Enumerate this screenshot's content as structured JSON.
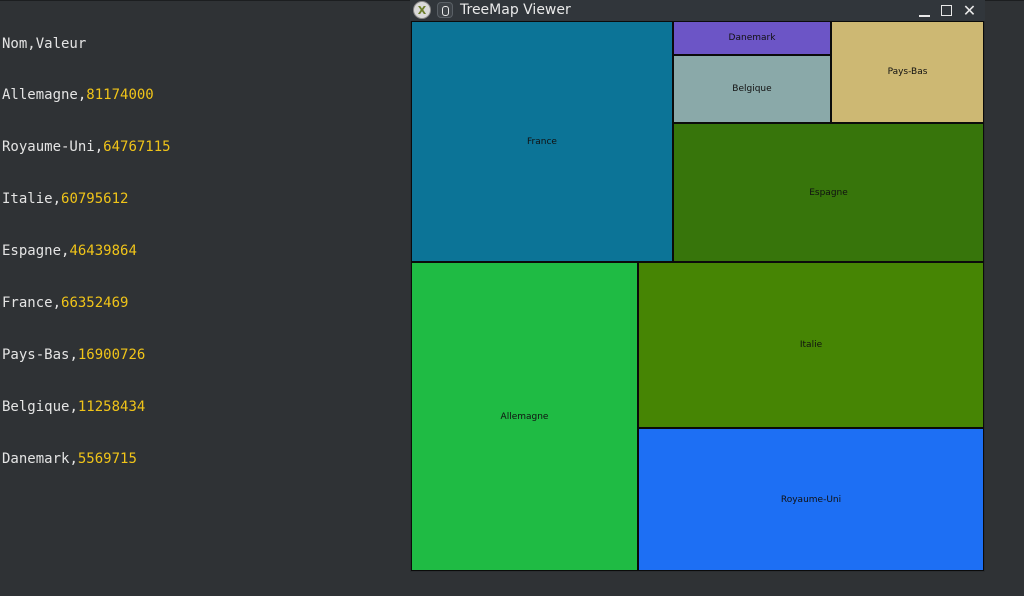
{
  "terminal": {
    "header": "Nom,Valeur",
    "rows": [
      {
        "name": "Allemagne",
        "value": "81174000"
      },
      {
        "name": "Royaume-Uni",
        "value": "64767115"
      },
      {
        "name": "Italie",
        "value": "60795612"
      },
      {
        "name": "Espagne",
        "value": "46439864"
      },
      {
        "name": "France",
        "value": "66352469"
      },
      {
        "name": "Pays-Bas",
        "value": "16900726"
      },
      {
        "name": "Belgique",
        "value": "11258434"
      },
      {
        "name": "Danemark",
        "value": "5569715"
      }
    ]
  },
  "window": {
    "title": "TreeMap Viewer",
    "app_icon": "x-app-icon",
    "close_glyph": "✕"
  },
  "treemap": {
    "tiles": [
      {
        "key": "france",
        "label": "France",
        "color": "#0c7497"
      },
      {
        "key": "danemark",
        "label": "Danemark",
        "color": "#6c55c6"
      },
      {
        "key": "belgique",
        "label": "Belgique",
        "color": "#8aa9a9"
      },
      {
        "key": "pays-bas",
        "label": "Pays-Bas",
        "color": "#cdb873"
      },
      {
        "key": "espagne",
        "label": "Espagne",
        "color": "#37750b"
      },
      {
        "key": "allemagne",
        "label": "Allemagne",
        "color": "#1fbb44"
      },
      {
        "key": "italie",
        "label": "Italie",
        "color": "#468504"
      },
      {
        "key": "royaume-uni",
        "label": "Royaume-Uni",
        "color": "#1d6ff4"
      }
    ]
  }
}
